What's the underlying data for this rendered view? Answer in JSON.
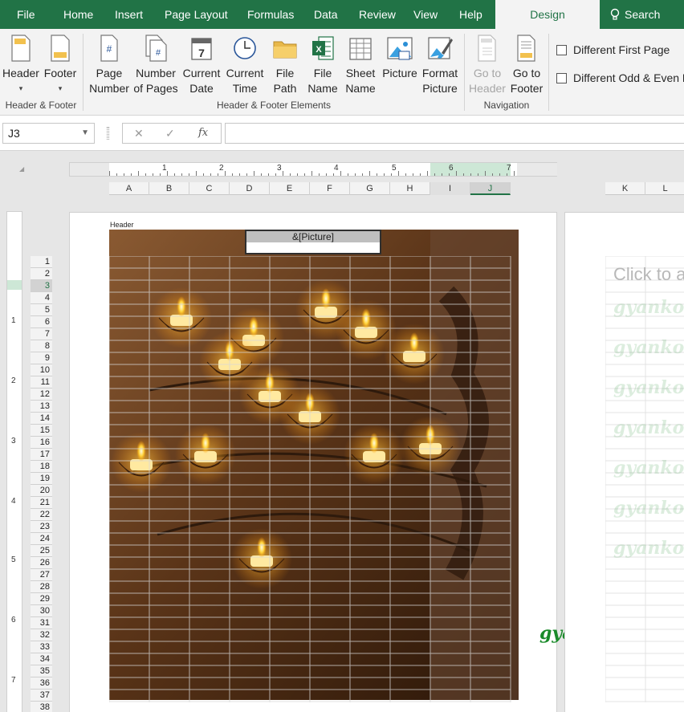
{
  "tabs": [
    {
      "label": "File"
    },
    {
      "label": "Home"
    },
    {
      "label": "Insert"
    },
    {
      "label": "Page Layout"
    },
    {
      "label": "Formulas"
    },
    {
      "label": "Data"
    },
    {
      "label": "Review"
    },
    {
      "label": "View"
    },
    {
      "label": "Help"
    },
    {
      "label": "Design"
    }
  ],
  "search_label": "Search",
  "ribbon": {
    "header_label": "Header",
    "footer_label": "Footer",
    "page_number": [
      "Page",
      "Number"
    ],
    "number_of_pages": [
      "Number",
      "of Pages"
    ],
    "current_date": [
      "Current",
      "Date"
    ],
    "current_time": [
      "Current",
      "Time"
    ],
    "file_path": [
      "File",
      "Path"
    ],
    "file_name": [
      "File",
      "Name"
    ],
    "sheet_name": [
      "Sheet",
      "Name"
    ],
    "picture": "Picture",
    "format_picture": [
      "Format",
      "Picture"
    ],
    "go_to_header": [
      "Go to",
      "Header"
    ],
    "go_to_footer": [
      "Go to",
      "Footer"
    ],
    "group_header_footer": "Header & Footer",
    "group_elements": "Header & Footer Elements",
    "group_navigation": "Navigation",
    "diff_first_page": "Different First Page",
    "diff_odd_even": "Different Odd & Even Pages"
  },
  "formula_bar": {
    "name_box": "J3",
    "cancel_symbol": "✕",
    "enter_symbol": "✓",
    "fx_symbol": "fx",
    "value": ""
  },
  "ruler_numbers": [
    "1",
    "2",
    "3",
    "4",
    "5",
    "6",
    "7"
  ],
  "columns": [
    "A",
    "B",
    "C",
    "D",
    "E",
    "F",
    "G",
    "H",
    "I",
    "J"
  ],
  "columns_page2": [
    "K",
    "L"
  ],
  "vruler_numbers": [
    "1",
    "2",
    "3",
    "4",
    "5",
    "6",
    "7"
  ],
  "rows": [
    "1",
    "2",
    "3",
    "4",
    "5",
    "6",
    "7",
    "8",
    "9",
    "10",
    "11",
    "12",
    "13",
    "14",
    "15",
    "16",
    "17",
    "18",
    "19",
    "20",
    "21",
    "22",
    "23",
    "24",
    "25",
    "26",
    "27",
    "28",
    "29",
    "30",
    "31",
    "32",
    "33",
    "34",
    "35",
    "36",
    "37",
    "38"
  ],
  "header_section_label": "Header",
  "picture_field": "&[Picture]",
  "page2_prompt": "Click to a",
  "watermark": "gyankosh.net",
  "colors": {
    "accent": "#217346",
    "arrow": "#e01b1b",
    "watermark": "#1a8a2a"
  }
}
